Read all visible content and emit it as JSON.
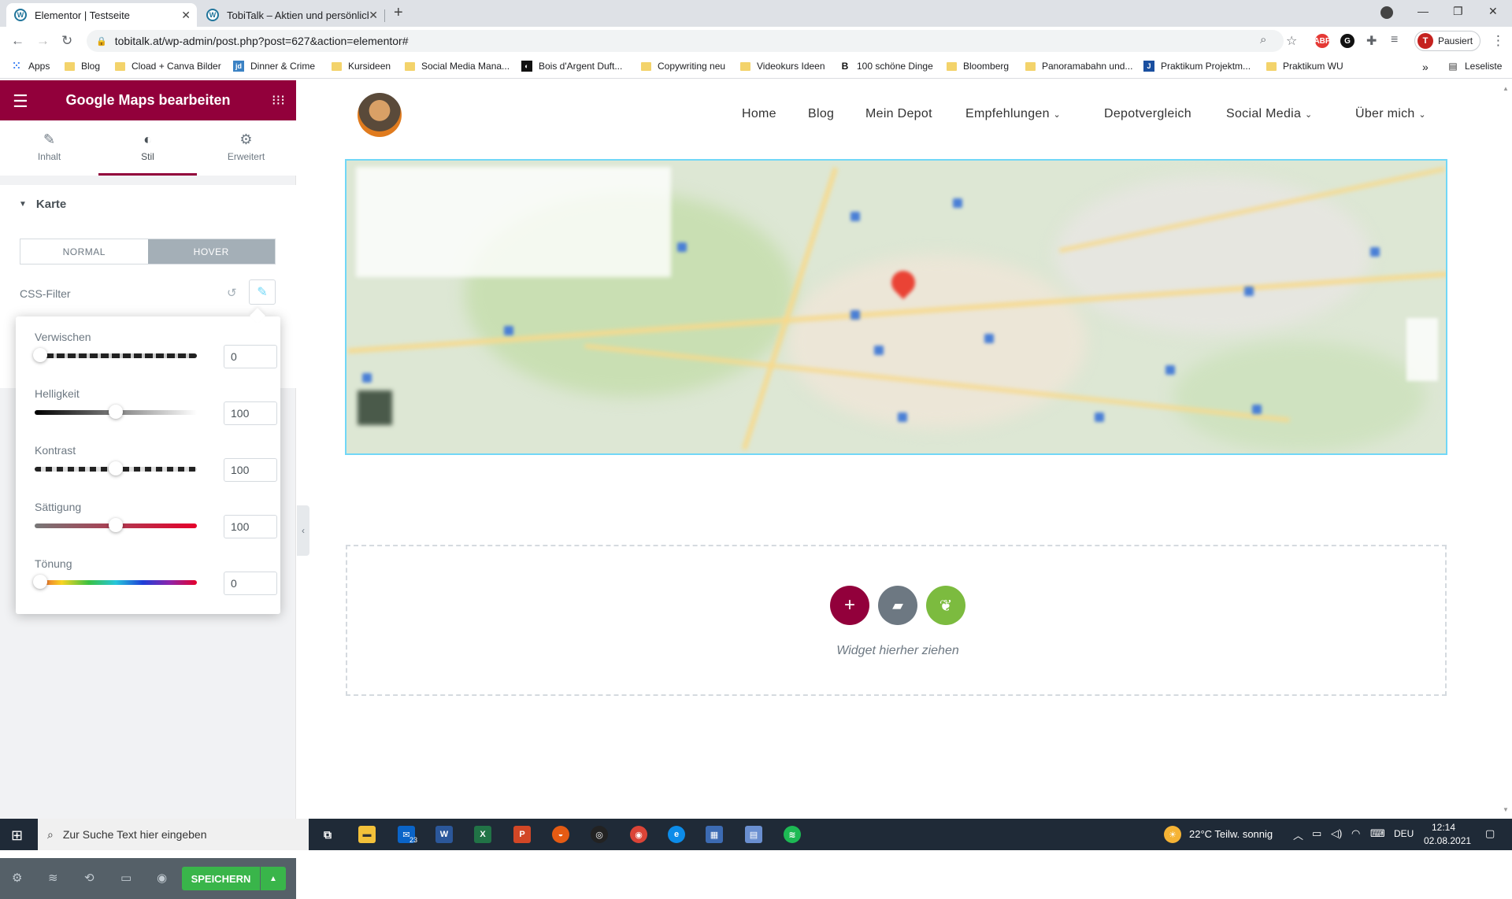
{
  "browser": {
    "tabs": [
      {
        "label": "Elementor | Testseite",
        "active": true
      },
      {
        "label": "TobiTalk – Aktien und persönliche",
        "active": false
      }
    ],
    "url": "tobitalk.at/wp-admin/post.php?post=627&action=elementor#",
    "profile_label": "Pausiert",
    "profile_initial": "T",
    "bookmarks": [
      "Apps",
      "Blog",
      "Cload + Canva Bilder",
      "Dinner & Crime",
      "Kursideen",
      "Social Media Mana...",
      "Bois d'Argent Duft...",
      "Copywriting neu",
      "Videokurs Ideen",
      "100 schöne Dinge",
      "Bloomberg",
      "Panoramabahn und...",
      "Praktikum Projektm...",
      "Praktikum WU"
    ],
    "reading_list": "Leseliste",
    "overflow": "»"
  },
  "panel": {
    "title": "Google Maps bearbeiten",
    "tabs": [
      {
        "label": "Inhalt",
        "icon": "pencil-icon"
      },
      {
        "label": "Stil",
        "icon": "contrast-icon"
      },
      {
        "label": "Erweitert",
        "icon": "gear-icon"
      }
    ],
    "section": "Karte",
    "state_normal": "NORMAL",
    "state_hover": "HOVER",
    "css_filter_label": "CSS-Filter",
    "filters": [
      {
        "label": "Verwischen",
        "value": "0",
        "fraction": 0.0
      },
      {
        "label": "Helligkeit",
        "value": "100",
        "fraction": 0.5
      },
      {
        "label": "Kontrast",
        "value": "100",
        "fraction": 0.5
      },
      {
        "label": "Sättigung",
        "value": "100",
        "fraction": 0.5
      },
      {
        "label": "Tönung",
        "value": "0",
        "fraction": 0.0
      }
    ],
    "save_label": "SPEICHERN"
  },
  "site": {
    "nav": [
      "Home",
      "Blog",
      "Mein Depot",
      "Empfehlungen",
      "Depotvergleich",
      "Social Media",
      "Über mich"
    ],
    "dropzone_text": "Widget hierher ziehen"
  },
  "taskbar": {
    "search_placeholder": "Zur Suche Text hier eingeben",
    "weather": "22°C  Teilw. sonnig",
    "language": "DEU",
    "time": "12:14",
    "date": "02.08.2021",
    "mail_badge": "23"
  },
  "colors": {
    "elementor_brand": "#92003b",
    "save_green": "#39b54a",
    "accent_cyan": "#71d7f7"
  }
}
